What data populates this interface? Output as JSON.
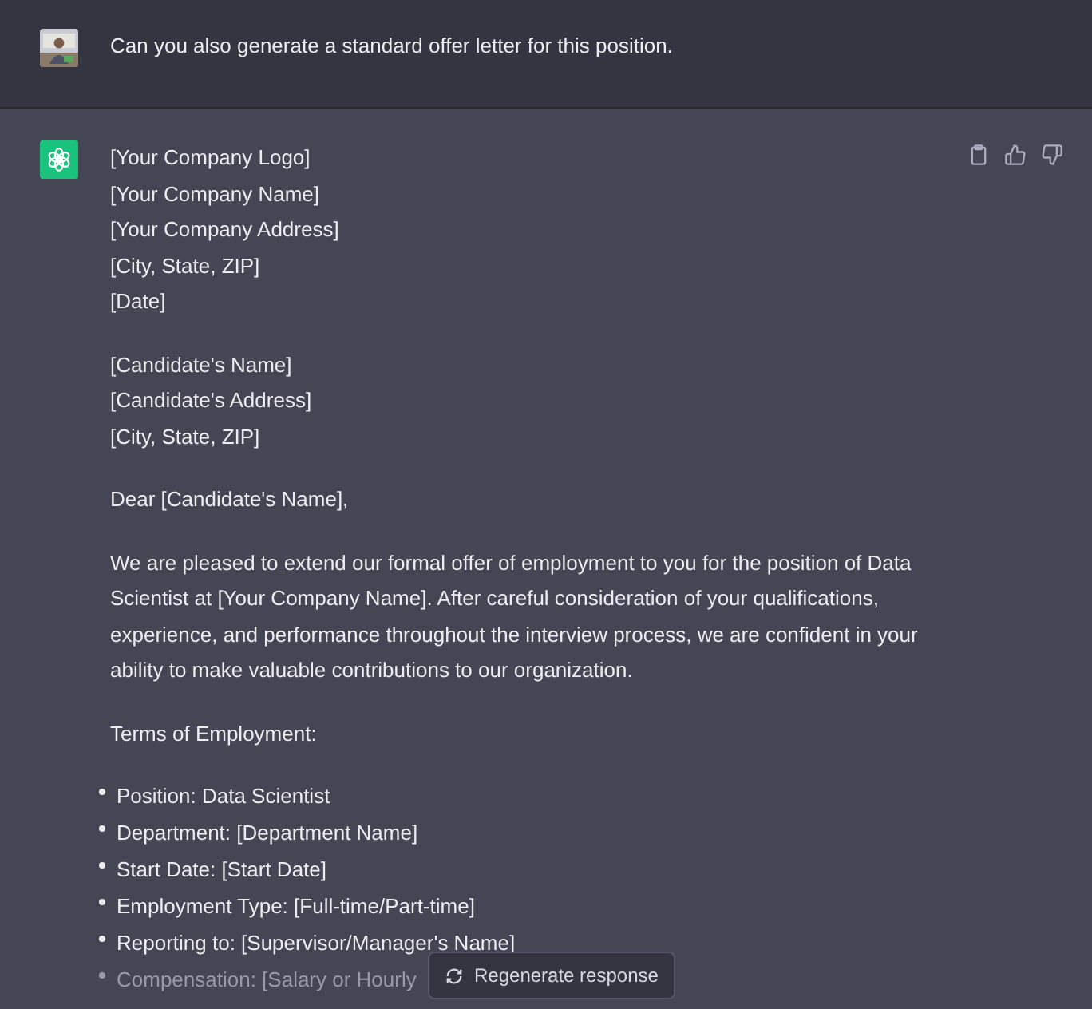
{
  "user_message": {
    "text": "Can you also generate a standard offer letter for this position."
  },
  "assistant_message": {
    "address_blocks": [
      [
        "[Your Company Logo]",
        "[Your Company Name]",
        "[Your Company Address]",
        "[City, State, ZIP]",
        "[Date]"
      ],
      [
        "[Candidate's Name]",
        "[Candidate's Address]",
        "[City, State, ZIP]"
      ]
    ],
    "salutation": "Dear [Candidate's Name],",
    "paragraphs": [
      "We are pleased to extend our formal offer of employment to you for the position of Data Scientist at [Your Company Name]. After careful consideration of your qualifications, experience, and performance throughout the interview process, we are confident in your ability to make valuable contributions to our organization."
    ],
    "terms_heading": "Terms of Employment:",
    "terms": [
      {
        "text": "Position: Data Scientist",
        "faded": false
      },
      {
        "text": "Department: [Department Name]",
        "faded": false
      },
      {
        "text": "Start Date: [Start Date]",
        "faded": false
      },
      {
        "text": "Employment Type: [Full-time/Part-time]",
        "faded": false
      },
      {
        "text": "Reporting to: [Supervisor/Manager's Name]",
        "faded": false
      },
      {
        "text": "Compensation: [Salary or Hourly",
        "faded": true
      }
    ]
  },
  "regenerate_button": {
    "label": "Regenerate response"
  }
}
